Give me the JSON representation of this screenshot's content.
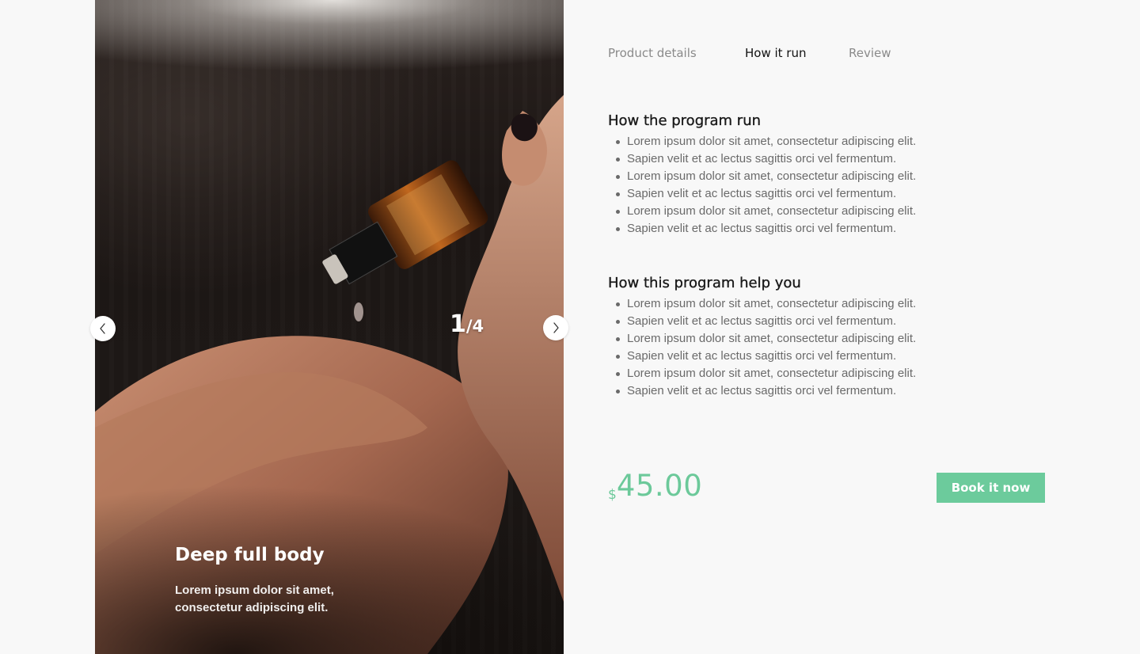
{
  "carousel": {
    "current": "1",
    "separator": "/",
    "total": "4",
    "slide_title": "Deep full body",
    "slide_description": "Lorem ipsum dolor sit amet, consectetur adipiscing elit.",
    "prev_icon": "chevron-left-icon",
    "next_icon": "chevron-right-icon"
  },
  "tabs": [
    {
      "label": "Product details",
      "active": false
    },
    {
      "label": "How it run",
      "active": true
    },
    {
      "label": "Review",
      "active": false
    }
  ],
  "sections": [
    {
      "title": "How the program run",
      "items": [
        "Lorem ipsum dolor sit amet, consectetur adipiscing elit.",
        "Sapien velit et ac lectus sagittis orci vel fermentum.",
        "Lorem ipsum dolor sit amet, consectetur adipiscing elit.",
        "Sapien velit et ac lectus sagittis orci vel fermentum.",
        "Lorem ipsum dolor sit amet, consectetur adipiscing elit.",
        "Sapien velit et ac lectus sagittis orci vel fermentum."
      ]
    },
    {
      "title": "How this program help you",
      "items": [
        "Lorem ipsum dolor sit amet, consectetur adipiscing elit.",
        "Sapien velit et ac lectus sagittis orci vel fermentum.",
        "Lorem ipsum dolor sit amet, consectetur adipiscing elit.",
        "Sapien velit et ac lectus sagittis orci vel fermentum.",
        "Lorem ipsum dolor sit amet, consectetur adipiscing elit.",
        "Sapien velit et ac lectus sagittis orci vel fermentum."
      ]
    }
  ],
  "price": {
    "currency": "$",
    "amount": "45.00"
  },
  "book_button": {
    "label": "Book it now"
  },
  "colors": {
    "accent": "#6ccb9c",
    "page_bg": "#f8f8f8",
    "text_muted": "#6a6a6a",
    "tab_inactive": "#8a8a8a"
  }
}
